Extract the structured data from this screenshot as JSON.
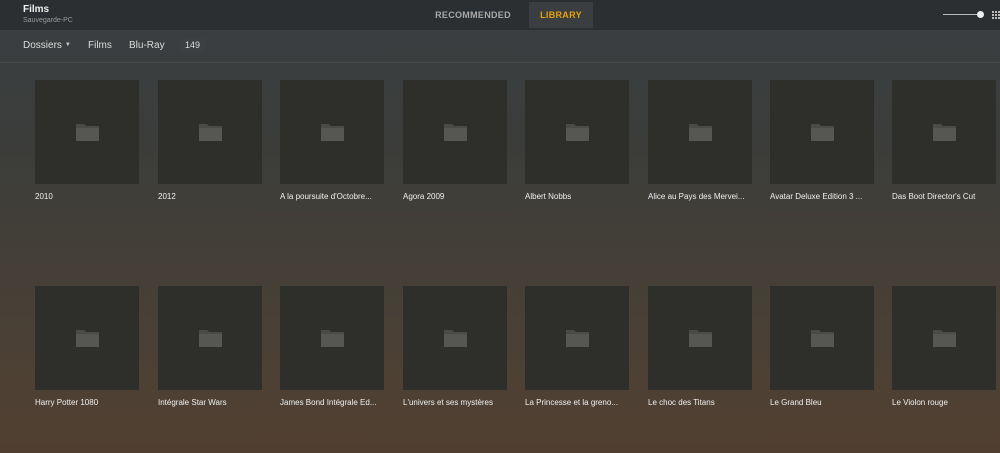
{
  "header": {
    "library_title": "Films",
    "server_name": "Sauvegarde-PC",
    "tabs": [
      {
        "label": "RECOMMENDED",
        "active": false
      },
      {
        "label": "LIBRARY",
        "active": true
      }
    ],
    "accent_color": "#e5a00d"
  },
  "toolbar": {
    "folders_label": "Dossiers",
    "films_label": "Films",
    "bluray_label": "Blu-Ray",
    "count": "149"
  },
  "rows": [
    {
      "items": [
        {
          "title": "2010"
        },
        {
          "title": "2012"
        },
        {
          "title": "A la poursuite d'Octobre..."
        },
        {
          "title": "Agora 2009"
        },
        {
          "title": "Albert Nobbs"
        },
        {
          "title": "Alice au Pays des Mervei..."
        },
        {
          "title": "Avatar Deluxe Edition 3 ..."
        },
        {
          "title": "Das Boot Director's Cut"
        }
      ]
    },
    {
      "items": [
        {
          "title": "Harry Potter 1080"
        },
        {
          "title": "Intégrale Star Wars"
        },
        {
          "title": "James Bond Intégrale Ed..."
        },
        {
          "title": "L'univers et ses mystères"
        },
        {
          "title": "La Princesse et la greno..."
        },
        {
          "title": "Le choc des Titans"
        },
        {
          "title": "Le Grand Bleu"
        },
        {
          "title": "Le Violon rouge"
        }
      ]
    }
  ]
}
